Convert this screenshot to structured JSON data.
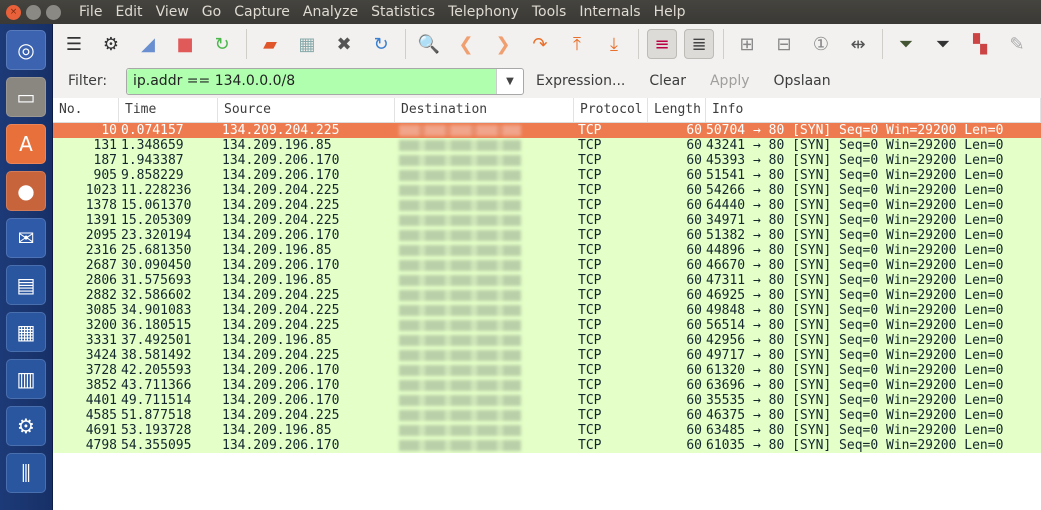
{
  "menubar": {
    "items": [
      "File",
      "Edit",
      "View",
      "Go",
      "Capture",
      "Analyze",
      "Statistics",
      "Telephony",
      "Tools",
      "Internals",
      "Help"
    ]
  },
  "launcher": {
    "items": [
      "ubuntu-dash",
      "files",
      "software-center",
      "firefox",
      "thunderbird",
      "libreoffice-impress-draw",
      "libreoffice-calc",
      "libreoffice-impress",
      "system-settings",
      "mixer"
    ]
  },
  "toolbar": {
    "icons": [
      "interfaces",
      "options",
      "start-capture",
      "stop-capture",
      "restart-capture",
      "open-file",
      "save-file",
      "close-file",
      "reload",
      "find",
      "go-back",
      "go-forward",
      "go-to-packet",
      "first-packet",
      "last-packet",
      "colorize",
      "auto-scroll",
      "zoom-in",
      "zoom-out",
      "normal-size",
      "resize-columns",
      "capture-filters",
      "display-filters",
      "coloring-rules",
      "preferences"
    ]
  },
  "filter": {
    "label": "Filter:",
    "value": "ip.addr == 134.0.0.0/8",
    "expression": "Expression...",
    "clear": "Clear",
    "apply": "Apply",
    "save": "Opslaan"
  },
  "colors": {
    "selected_row": "#ee7b4f",
    "tcp_row": "#e4ffc7",
    "filter_valid": "#afffaf"
  },
  "columns": [
    "No.",
    "Time",
    "Source",
    "Destination",
    "Protocol",
    "Length",
    "Info"
  ],
  "packets": [
    {
      "no": "10",
      "time": "0.074157",
      "src": "134.209.204.225",
      "proto": "TCP",
      "len": "60",
      "info": "50704 → 80 [SYN] Seq=0 Win=29200 Len=0",
      "selected": true
    },
    {
      "no": "131",
      "time": "1.348659",
      "src": "134.209.196.85",
      "proto": "TCP",
      "len": "60",
      "info": "43241 → 80 [SYN] Seq=0 Win=29200 Len=0"
    },
    {
      "no": "187",
      "time": "1.943387",
      "src": "134.209.206.170",
      "proto": "TCP",
      "len": "60",
      "info": "45393 → 80 [SYN] Seq=0 Win=29200 Len=0"
    },
    {
      "no": "905",
      "time": "9.858229",
      "src": "134.209.206.170",
      "proto": "TCP",
      "len": "60",
      "info": "51541 → 80 [SYN] Seq=0 Win=29200 Len=0"
    },
    {
      "no": "1023",
      "time": "11.228236",
      "src": "134.209.204.225",
      "proto": "TCP",
      "len": "60",
      "info": "54266 → 80 [SYN] Seq=0 Win=29200 Len=0"
    },
    {
      "no": "1378",
      "time": "15.061370",
      "src": "134.209.204.225",
      "proto": "TCP",
      "len": "60",
      "info": "64440 → 80 [SYN] Seq=0 Win=29200 Len=0"
    },
    {
      "no": "1391",
      "time": "15.205309",
      "src": "134.209.204.225",
      "proto": "TCP",
      "len": "60",
      "info": "34971 → 80 [SYN] Seq=0 Win=29200 Len=0"
    },
    {
      "no": "2095",
      "time": "23.320194",
      "src": "134.209.206.170",
      "proto": "TCP",
      "len": "60",
      "info": "51382 → 80 [SYN] Seq=0 Win=29200 Len=0"
    },
    {
      "no": "2316",
      "time": "25.681350",
      "src": "134.209.196.85",
      "proto": "TCP",
      "len": "60",
      "info": "44896 → 80 [SYN] Seq=0 Win=29200 Len=0"
    },
    {
      "no": "2687",
      "time": "30.090450",
      "src": "134.209.206.170",
      "proto": "TCP",
      "len": "60",
      "info": "46670 → 80 [SYN] Seq=0 Win=29200 Len=0"
    },
    {
      "no": "2806",
      "time": "31.575693",
      "src": "134.209.196.85",
      "proto": "TCP",
      "len": "60",
      "info": "47311 → 80 [SYN] Seq=0 Win=29200 Len=0"
    },
    {
      "no": "2882",
      "time": "32.586602",
      "src": "134.209.204.225",
      "proto": "TCP",
      "len": "60",
      "info": "46925 → 80 [SYN] Seq=0 Win=29200 Len=0"
    },
    {
      "no": "3085",
      "time": "34.901083",
      "src": "134.209.204.225",
      "proto": "TCP",
      "len": "60",
      "info": "49848 → 80 [SYN] Seq=0 Win=29200 Len=0"
    },
    {
      "no": "3200",
      "time": "36.180515",
      "src": "134.209.204.225",
      "proto": "TCP",
      "len": "60",
      "info": "56514 → 80 [SYN] Seq=0 Win=29200 Len=0"
    },
    {
      "no": "3331",
      "time": "37.492501",
      "src": "134.209.196.85",
      "proto": "TCP",
      "len": "60",
      "info": "42956 → 80 [SYN] Seq=0 Win=29200 Len=0"
    },
    {
      "no": "3424",
      "time": "38.581492",
      "src": "134.209.204.225",
      "proto": "TCP",
      "len": "60",
      "info": "49717 → 80 [SYN] Seq=0 Win=29200 Len=0"
    },
    {
      "no": "3728",
      "time": "42.205593",
      "src": "134.209.206.170",
      "proto": "TCP",
      "len": "60",
      "info": "61320 → 80 [SYN] Seq=0 Win=29200 Len=0"
    },
    {
      "no": "3852",
      "time": "43.711366",
      "src": "134.209.206.170",
      "proto": "TCP",
      "len": "60",
      "info": "63696 → 80 [SYN] Seq=0 Win=29200 Len=0"
    },
    {
      "no": "4401",
      "time": "49.711514",
      "src": "134.209.206.170",
      "proto": "TCP",
      "len": "60",
      "info": "35535 → 80 [SYN] Seq=0 Win=29200 Len=0"
    },
    {
      "no": "4585",
      "time": "51.877518",
      "src": "134.209.204.225",
      "proto": "TCP",
      "len": "60",
      "info": "46375 → 80 [SYN] Seq=0 Win=29200 Len=0"
    },
    {
      "no": "4691",
      "time": "53.193728",
      "src": "134.209.196.85",
      "proto": "TCP",
      "len": "60",
      "info": "63485 → 80 [SYN] Seq=0 Win=29200 Len=0"
    },
    {
      "no": "4798",
      "time": "54.355095",
      "src": "134.209.206.170",
      "proto": "TCP",
      "len": "60",
      "info": "61035 → 80 [SYN] Seq=0 Win=29200 Len=0"
    }
  ]
}
